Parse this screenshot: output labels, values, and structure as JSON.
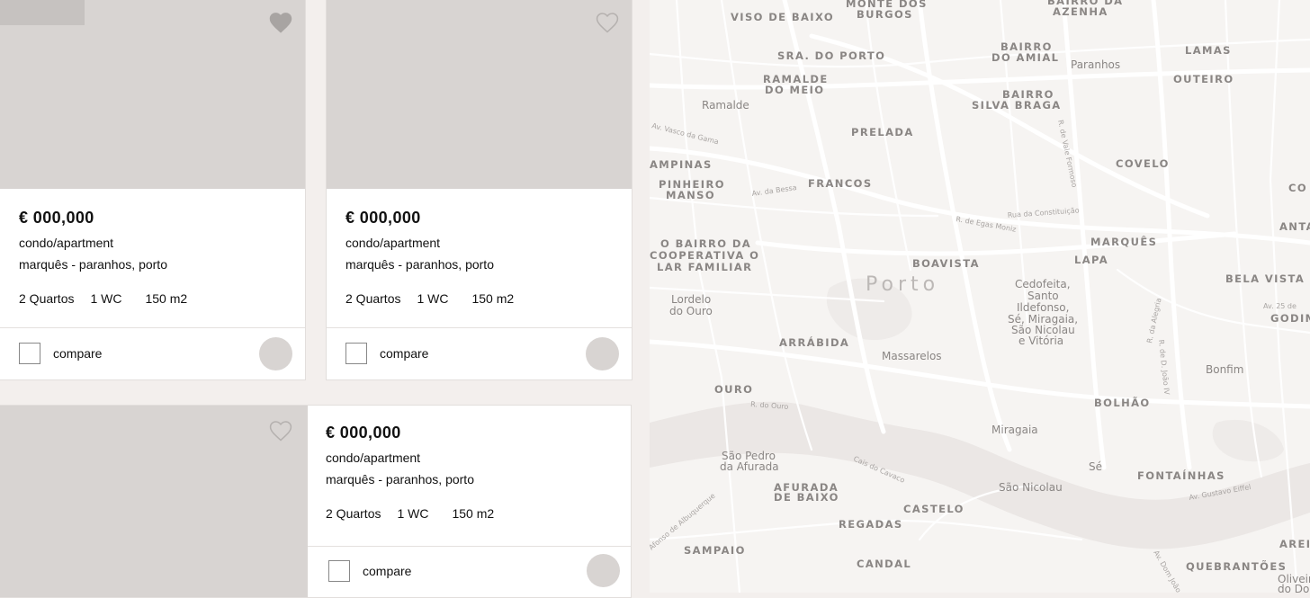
{
  "listings": [
    {
      "price": "€ 000,000",
      "type": "condo/apartment",
      "location": "marquês - paranhos, porto",
      "rooms": "2 Quartos",
      "baths": "1 WC",
      "area": "150 m2",
      "compare_label": "compare",
      "favorited": true
    },
    {
      "price": "€ 000,000",
      "type": "condo/apartment",
      "location": "marquês - paranhos, porto",
      "rooms": "2 Quartos",
      "baths": "1 WC",
      "area": "150 m2",
      "compare_label": "compare",
      "favorited": false
    },
    {
      "price": "€ 000,000",
      "type": "condo/apartment",
      "location": "marquês - paranhos, porto",
      "rooms": "2 Quartos",
      "baths": "1 WC",
      "area": "150 m2",
      "compare_label": "compare",
      "favorited": false
    }
  ],
  "colors": {
    "photo_placeholder": "#d8d4d2",
    "heart_filled": "#a8a4a2",
    "heart_outline": "#b5b1af",
    "page_bg": "#f3efed"
  },
  "map": {
    "city": "Porto",
    "districts": [
      {
        "text": "VISO DE BAIXO"
      },
      {
        "text": "MONTE DOS"
      },
      {
        "text": "BURGOS"
      },
      {
        "text": "BAIRRO DA"
      },
      {
        "text": "AZENHA"
      },
      {
        "text": "SRA. DO PORTO"
      },
      {
        "text": "BAIRRO"
      },
      {
        "text": "DO AMIAL"
      },
      {
        "text": "LAMAS"
      },
      {
        "text": "RAMALDE"
      },
      {
        "text": "DO MEIO"
      },
      {
        "text": "OUTEIRO"
      },
      {
        "text": "BAIRRO"
      },
      {
        "text": "SILVA BRAGA"
      },
      {
        "text": "PRELADA"
      },
      {
        "text": "AMPINAS"
      },
      {
        "text": "COVELO"
      },
      {
        "text": "PINHEIRO"
      },
      {
        "text": "MANSO"
      },
      {
        "text": "FRANCOS"
      },
      {
        "text": "CO"
      },
      {
        "text": "ANTAS"
      },
      {
        "text": "O BAIRRO DA"
      },
      {
        "text": "COOPERATIVA O"
      },
      {
        "text": "LAR FAMILIAR"
      },
      {
        "text": "MARQUÊS"
      },
      {
        "text": "LAPA"
      },
      {
        "text": "BOAVISTA"
      },
      {
        "text": "BELA VISTA"
      },
      {
        "text": "GODIM"
      },
      {
        "text": "ARRÁBIDA"
      },
      {
        "text": "OURO"
      },
      {
        "text": "BOLHÃO"
      },
      {
        "text": "FONTAÍNHAS"
      },
      {
        "text": "AFURADA"
      },
      {
        "text": "DE BAIXO"
      },
      {
        "text": "CASTELO"
      },
      {
        "text": "REGADAS"
      },
      {
        "text": "SAMPAIO"
      },
      {
        "text": "CANDAL"
      },
      {
        "text": "AREIN"
      },
      {
        "text": "QUEBRANTÕES"
      }
    ],
    "places": [
      {
        "text": "Paranhos"
      },
      {
        "text": "Ramalde"
      },
      {
        "text": "Lordelo"
      },
      {
        "text": "do Ouro"
      },
      {
        "text": "Cedofeita,"
      },
      {
        "text": "Santo"
      },
      {
        "text": "Ildefonso,"
      },
      {
        "text": "Sé, Miragaia,"
      },
      {
        "text": "São Nicolau"
      },
      {
        "text": "e Vitória"
      },
      {
        "text": "Massarelos"
      },
      {
        "text": "Bonfim"
      },
      {
        "text": "Miragaia"
      },
      {
        "text": "São Pedro"
      },
      {
        "text": "da Afurada"
      },
      {
        "text": "Sé"
      },
      {
        "text": "São Nicolau"
      },
      {
        "text": "Oliveira"
      },
      {
        "text": "do Douro"
      }
    ],
    "streets": [
      {
        "text": "Av. Vasco da Gama"
      },
      {
        "text": "Av. da Bessa"
      },
      {
        "text": "R. de Egas Moniz"
      },
      {
        "text": "Rua da Constituição"
      },
      {
        "text": "R. de Vale Formoso"
      },
      {
        "text": "R. da Alegria"
      },
      {
        "text": "R. de D. João IV"
      },
      {
        "text": "Av. 25 de"
      },
      {
        "text": "R. do Ouro"
      },
      {
        "text": "Cais do Cavaco"
      },
      {
        "text": "Av. Gustavo Eiffel"
      },
      {
        "text": "Afonso de Albuquerque"
      },
      {
        "text": "Av. Dom João"
      }
    ]
  }
}
